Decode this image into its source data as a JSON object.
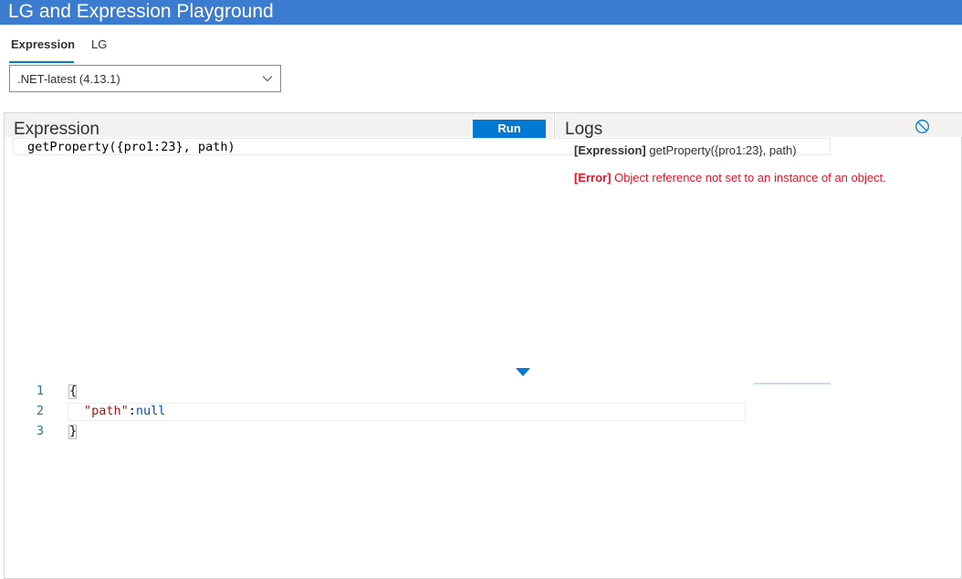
{
  "app": {
    "title": "LG and Expression Playground"
  },
  "tabs": [
    {
      "label": "Expression",
      "active": true
    },
    {
      "label": "LG",
      "active": false
    }
  ],
  "version_select": {
    "selected": ".NET-latest (4.13.1)"
  },
  "expression_panel": {
    "title": "Expression",
    "run_label": "Run",
    "expression": "getProperty({pro1:23}, path)"
  },
  "logs_panel": {
    "title": "Logs",
    "clear_icon": "clear-circle-slash-icon",
    "entries": [
      {
        "tag": "[Expression]",
        "message": "getProperty({pro1:23}, path)",
        "color": "#323130"
      },
      {
        "tag": "[Error]",
        "message": "Object reference not set to an instance of an object.",
        "color": "#e81123"
      }
    ]
  },
  "data_editor": {
    "line_numbers": [
      "1",
      "2",
      "3"
    ],
    "open_brace": "{",
    "close_brace": "}",
    "key": "\"path\"",
    "colon": ":",
    "value": "null"
  },
  "colors": {
    "titlebar": "#3b7bd0",
    "accent": "#0078d4",
    "error": "#e81123",
    "string": "#a31515",
    "keyword": "#0451a5"
  }
}
